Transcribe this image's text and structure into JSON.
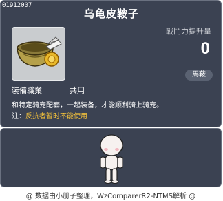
{
  "item": {
    "id": "01912007",
    "name": "乌龟皮鞍子",
    "icon": "turtle-shell-saddle-icon"
  },
  "stat": {
    "label": "戰鬥力提升量",
    "value": "0"
  },
  "type_badge": "馬鞍",
  "job": {
    "label": "裝備職業",
    "value": "共用"
  },
  "description": "和特定骑宠配套，一起装备，才能顺利骑上骑宠。",
  "note": {
    "prefix": "注：",
    "warning": "反抗者暂时不能使用"
  },
  "preview": {
    "avatar": "mannequin-avatar"
  },
  "footer": "@ 数据由小册子整理，WzComparerR2-NTMS解析 @",
  "colors": {
    "panel": "#3b4252",
    "warning": "#f3c13b"
  }
}
